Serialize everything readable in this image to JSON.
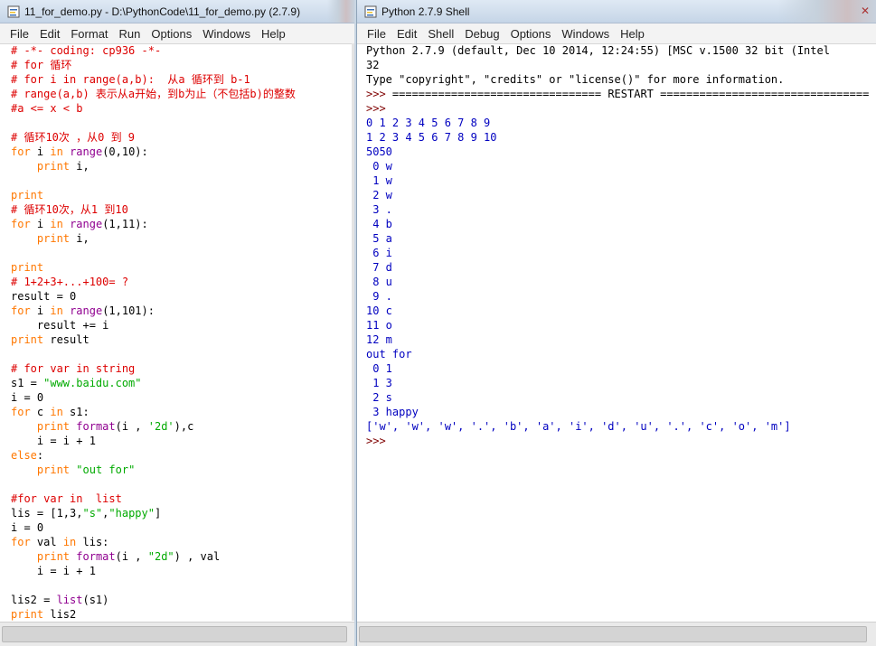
{
  "editor": {
    "title": "11_for_demo.py - D:\\PythonCode\\11_for_demo.py (2.7.9)",
    "menu": [
      "File",
      "Edit",
      "Format",
      "Run",
      "Options",
      "Windows",
      "Help"
    ],
    "lines": [
      [
        {
          "t": "# -*- coding: cp936 -*-",
          "c": "com"
        }
      ],
      [
        {
          "t": "# for 循环",
          "c": "com"
        }
      ],
      [
        {
          "t": "# for i in range(a,b):  从a 循环到 b-1",
          "c": "com"
        }
      ],
      [
        {
          "t": "# range(a,b) 表示从a开始，到b为止（不包括b)的整数",
          "c": "com"
        }
      ],
      [
        {
          "t": "#a <= x < b",
          "c": "com"
        }
      ],
      [],
      [
        {
          "t": "# 循环10次 ，从0 到 9",
          "c": "com"
        }
      ],
      [
        {
          "t": "for",
          "c": "kw"
        },
        {
          "t": " i ",
          "c": "def"
        },
        {
          "t": "in",
          "c": "kw"
        },
        {
          "t": " ",
          "c": "def"
        },
        {
          "t": "range",
          "c": "bi"
        },
        {
          "t": "(0,10):",
          "c": "def"
        }
      ],
      [
        {
          "t": "    ",
          "c": "def"
        },
        {
          "t": "print",
          "c": "kw"
        },
        {
          "t": " i,",
          "c": "def"
        }
      ],
      [],
      [
        {
          "t": "print",
          "c": "kw"
        }
      ],
      [
        {
          "t": "# 循环10次，从1 到10",
          "c": "com"
        }
      ],
      [
        {
          "t": "for",
          "c": "kw"
        },
        {
          "t": " i ",
          "c": "def"
        },
        {
          "t": "in",
          "c": "kw"
        },
        {
          "t": " ",
          "c": "def"
        },
        {
          "t": "range",
          "c": "bi"
        },
        {
          "t": "(1,11):",
          "c": "def"
        }
      ],
      [
        {
          "t": "    ",
          "c": "def"
        },
        {
          "t": "print",
          "c": "kw"
        },
        {
          "t": " i,",
          "c": "def"
        }
      ],
      [],
      [
        {
          "t": "print",
          "c": "kw"
        }
      ],
      [
        {
          "t": "# 1+2+3+...+100= ?",
          "c": "com"
        }
      ],
      [
        {
          "t": "result = 0",
          "c": "def"
        }
      ],
      [
        {
          "t": "for",
          "c": "kw"
        },
        {
          "t": " i ",
          "c": "def"
        },
        {
          "t": "in",
          "c": "kw"
        },
        {
          "t": " ",
          "c": "def"
        },
        {
          "t": "range",
          "c": "bi"
        },
        {
          "t": "(1,101):",
          "c": "def"
        }
      ],
      [
        {
          "t": "    result += i",
          "c": "def"
        }
      ],
      [
        {
          "t": "print",
          "c": "kw"
        },
        {
          "t": " result",
          "c": "def"
        }
      ],
      [],
      [
        {
          "t": "# for var in string",
          "c": "com"
        }
      ],
      [
        {
          "t": "s1 = ",
          "c": "def"
        },
        {
          "t": "\"www.baidu.com\"",
          "c": "str"
        }
      ],
      [
        {
          "t": "i = 0",
          "c": "def"
        }
      ],
      [
        {
          "t": "for",
          "c": "kw"
        },
        {
          "t": " c ",
          "c": "def"
        },
        {
          "t": "in",
          "c": "kw"
        },
        {
          "t": " s1:",
          "c": "def"
        }
      ],
      [
        {
          "t": "    ",
          "c": "def"
        },
        {
          "t": "print",
          "c": "kw"
        },
        {
          "t": " ",
          "c": "def"
        },
        {
          "t": "format",
          "c": "bi"
        },
        {
          "t": "(i , ",
          "c": "def"
        },
        {
          "t": "'2d'",
          "c": "str"
        },
        {
          "t": "),c",
          "c": "def"
        }
      ],
      [
        {
          "t": "    i = i + 1",
          "c": "def"
        }
      ],
      [
        {
          "t": "else",
          "c": "kw"
        },
        {
          "t": ":",
          "c": "def"
        }
      ],
      [
        {
          "t": "    ",
          "c": "def"
        },
        {
          "t": "print",
          "c": "kw"
        },
        {
          "t": " ",
          "c": "def"
        },
        {
          "t": "\"out for\"",
          "c": "str"
        }
      ],
      [],
      [
        {
          "t": "#for var in  list",
          "c": "com"
        }
      ],
      [
        {
          "t": "lis = [1,3,",
          "c": "def"
        },
        {
          "t": "\"s\"",
          "c": "str"
        },
        {
          "t": ",",
          "c": "def"
        },
        {
          "t": "\"happy\"",
          "c": "str"
        },
        {
          "t": "]",
          "c": "def"
        }
      ],
      [
        {
          "t": "i = 0",
          "c": "def"
        }
      ],
      [
        {
          "t": "for",
          "c": "kw"
        },
        {
          "t": " val ",
          "c": "def"
        },
        {
          "t": "in",
          "c": "kw"
        },
        {
          "t": " lis:",
          "c": "def"
        }
      ],
      [
        {
          "t": "    ",
          "c": "def"
        },
        {
          "t": "print",
          "c": "kw"
        },
        {
          "t": " ",
          "c": "def"
        },
        {
          "t": "format",
          "c": "bi"
        },
        {
          "t": "(i , ",
          "c": "def"
        },
        {
          "t": "\"2d\"",
          "c": "str"
        },
        {
          "t": ") , val",
          "c": "def"
        }
      ],
      [
        {
          "t": "    i = i + 1",
          "c": "def"
        }
      ],
      [],
      [
        {
          "t": "lis2 = ",
          "c": "def"
        },
        {
          "t": "list",
          "c": "bi"
        },
        {
          "t": "(s1)",
          "c": "def"
        }
      ],
      [
        {
          "t": "print",
          "c": "kw"
        },
        {
          "t": " lis2",
          "c": "def"
        }
      ]
    ]
  },
  "shell": {
    "title": "Python 2.7.9 Shell",
    "menu": [
      "File",
      "Edit",
      "Shell",
      "Debug",
      "Options",
      "Windows",
      "Help"
    ],
    "lines": [
      [
        {
          "t": "Python 2.7.9 (default, Dec 10 2014, 12:24:55) [MSC v.1500 32 bit (Intel",
          "c": "def"
        }
      ],
      [
        {
          "t": "32",
          "c": "def"
        }
      ],
      [
        {
          "t": "Type \"copyright\", \"credits\" or \"license()\" for more information.",
          "c": "def"
        }
      ],
      [
        {
          "t": ">>> ",
          "c": "prompt"
        },
        {
          "t": "================================ RESTART ================================",
          "c": "def"
        }
      ],
      [
        {
          "t": ">>>",
          "c": "prompt"
        }
      ],
      [
        {
          "t": "0 1 2 3 4 5 6 7 8 9",
          "c": "out"
        }
      ],
      [
        {
          "t": "1 2 3 4 5 6 7 8 9 10",
          "c": "out"
        }
      ],
      [
        {
          "t": "5050",
          "c": "out"
        }
      ],
      [
        {
          "t": " 0 w",
          "c": "out"
        }
      ],
      [
        {
          "t": " 1 w",
          "c": "out"
        }
      ],
      [
        {
          "t": " 2 w",
          "c": "out"
        }
      ],
      [
        {
          "t": " 3 .",
          "c": "out"
        }
      ],
      [
        {
          "t": " 4 b",
          "c": "out"
        }
      ],
      [
        {
          "t": " 5 a",
          "c": "out"
        }
      ],
      [
        {
          "t": " 6 i",
          "c": "out"
        }
      ],
      [
        {
          "t": " 7 d",
          "c": "out"
        }
      ],
      [
        {
          "t": " 8 u",
          "c": "out"
        }
      ],
      [
        {
          "t": " 9 .",
          "c": "out"
        }
      ],
      [
        {
          "t": "10 c",
          "c": "out"
        }
      ],
      [
        {
          "t": "11 o",
          "c": "out"
        }
      ],
      [
        {
          "t": "12 m",
          "c": "out"
        }
      ],
      [
        {
          "t": "out for",
          "c": "out"
        }
      ],
      [
        {
          "t": " 0 1",
          "c": "out"
        }
      ],
      [
        {
          "t": " 1 3",
          "c": "out"
        }
      ],
      [
        {
          "t": " 2 s",
          "c": "out"
        }
      ],
      [
        {
          "t": " 3 happy",
          "c": "out"
        }
      ],
      [
        {
          "t": "['w', 'w', 'w', '.', 'b', 'a', 'i', 'd', 'u', '.', 'c', 'o', 'm']",
          "c": "out"
        }
      ],
      [
        {
          "t": ">>> ",
          "c": "prompt"
        }
      ]
    ]
  }
}
